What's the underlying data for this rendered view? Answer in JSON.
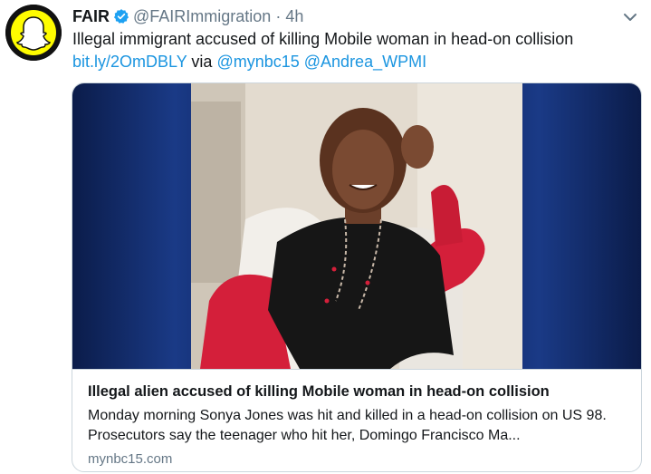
{
  "account": {
    "name": "FAIR",
    "handle": "@FAIRImmigration",
    "separator": "·",
    "time": "4h"
  },
  "tweet": {
    "text": "Illegal immigrant accused of killing Mobile woman in head-on collision",
    "link": "bit.ly/2OmDBLY",
    "via": "via",
    "mention1": "@mynbc15",
    "mention2": "@Andrea_WPMI"
  },
  "card": {
    "title": "Illegal alien accused of killing Mobile woman in head-on collision",
    "description": "Monday morning Sonya Jones was hit and killed in a head-on collision on US 98. Prosecutors say the teenager who hit her, Domingo Francisco Ma...",
    "domain": "mynbc15.com"
  },
  "colors": {
    "link": "#1b95e0",
    "secondary_text": "#657786",
    "border": "#ccd6dd",
    "verified": "#1da1f2"
  },
  "icons": {
    "avatar": "snapcode-ghost-icon",
    "verified": "verified-badge-icon",
    "menu": "chevron-down-icon"
  }
}
